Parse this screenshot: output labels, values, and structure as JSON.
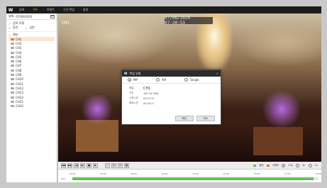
{
  "menu": {
    "logo": "W",
    "items": [
      "검색",
      "모두",
      "이벤트",
      "구간 백업",
      "설정"
    ],
    "active_index": 1
  },
  "left_panel": {
    "date_label": "날짜",
    "date_value": "07/06/2020",
    "option_label": "검색 모델",
    "option_a": "동반",
    "option_b": "금번",
    "group_label": "채널",
    "cameras": [
      "CH1",
      "CH2",
      "CH3",
      "CH4",
      "CH5",
      "CH6",
      "CH7",
      "CH8",
      "CH9",
      "CH10",
      "CH11",
      "CH12",
      "CH13",
      "CH14",
      "CH15",
      "CH16"
    ],
    "selected_index": 0
  },
  "video": {
    "channel": "CH1",
    "timestamp": "07/06/2020 07:30:53"
  },
  "dialog": {
    "logo": "W",
    "title": "백업 유형",
    "close": "×",
    "radios": [
      "MP",
      "AVI",
      "Single"
    ],
    "radio_selected": 0,
    "channel_label": "채널",
    "channel_value": "CH1",
    "size_label": "크기",
    "size_value": "162.44 SMB",
    "start_label": "시작시간",
    "start_value": "09:27:32",
    "end_label": "종료시간",
    "end_value": "09:44:27",
    "ok": "확인",
    "cancel": "취소"
  },
  "controls": {
    "buttons": [
      "◀◀",
      "▶▶",
      "|◀",
      "▶|",
      "■",
      "▶"
    ],
    "tool_buttons": [
      "⛶",
      "⊕",
      "⊖",
      "▦"
    ],
    "legend": [
      {
        "label": "일반",
        "color": "#5ec454"
      },
      {
        "label": "이벤트",
        "color": "#e07a30"
      }
    ],
    "ranges": [
      "24h",
      "2h",
      "1h"
    ],
    "range_selected": 0
  },
  "timeline": {
    "channel": "CH1",
    "ticks": [
      "00:00",
      "03:00",
      "06:00",
      "09:00",
      "12:00",
      "15:00",
      "18:00",
      "21:00",
      "24:00"
    ],
    "recorded_fraction": 0.98
  }
}
